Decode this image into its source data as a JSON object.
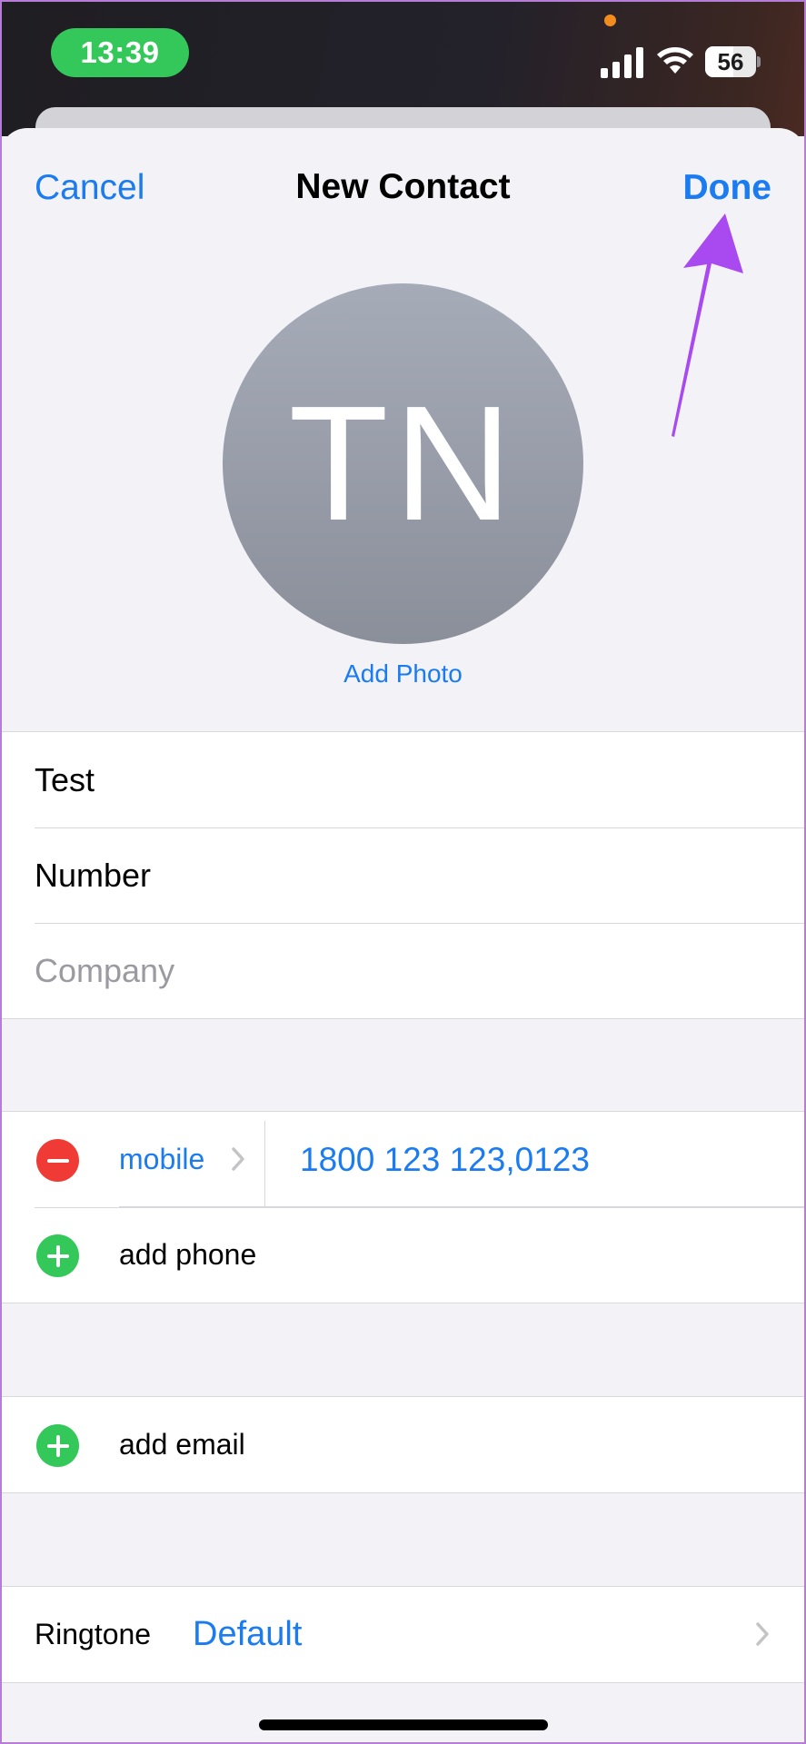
{
  "status_bar": {
    "time": "13:39",
    "battery": "56",
    "battery_level_percent": 56,
    "signal_icon": "cellular-signal-icon",
    "wifi_icon": "wifi-icon",
    "indicator_color": "#f28c1e"
  },
  "nav": {
    "cancel_label": "Cancel",
    "title": "New Contact",
    "done_label": "Done"
  },
  "avatar": {
    "initials": "TN",
    "add_photo_label": "Add Photo"
  },
  "name_fields": {
    "first_name": "Test",
    "last_name": "Number",
    "company_placeholder": "Company"
  },
  "phone": {
    "label": "mobile",
    "number": "1800 123 123,0123",
    "add_label": "add phone"
  },
  "email": {
    "add_label": "add email"
  },
  "ringtone": {
    "label": "Ringtone",
    "value": "Default"
  },
  "colors": {
    "accent": "#1a7cf0",
    "add": "#34c759",
    "remove": "#f03a35",
    "annotation_arrow": "#a94af0"
  }
}
